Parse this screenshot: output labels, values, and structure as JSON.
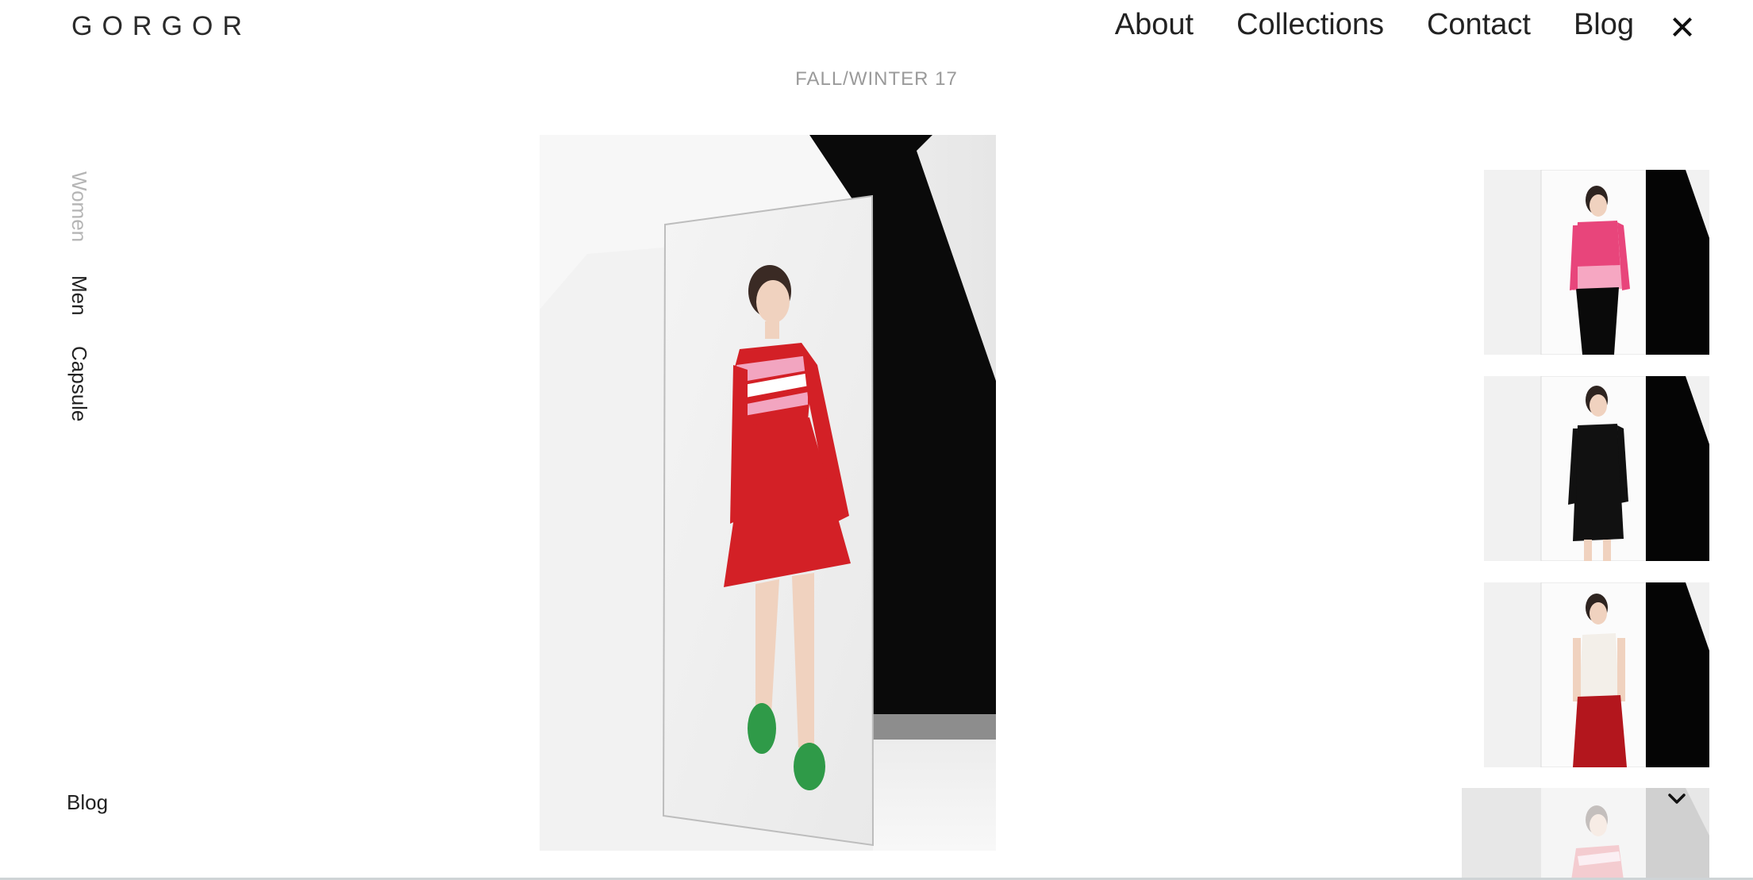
{
  "brand": {
    "logo_text": "GORGOR"
  },
  "header": {
    "nav": [
      {
        "label": "About"
      },
      {
        "label": "Collections"
      },
      {
        "label": "Contact"
      },
      {
        "label": "Blog"
      }
    ]
  },
  "collection": {
    "season": "FALL/WINTER 17"
  },
  "sidebar": {
    "categories": [
      {
        "label": "Women"
      },
      {
        "label": "Men"
      },
      {
        "label": "Capsule"
      }
    ],
    "blog_label": "Blog"
  },
  "colors": {
    "dress_red": "#d32026",
    "stripe_pink": "#f2a5c0",
    "socks_green": "#2f9a48",
    "sweater_pink": "#e8457b",
    "muted_text": "#9a9a9a"
  }
}
